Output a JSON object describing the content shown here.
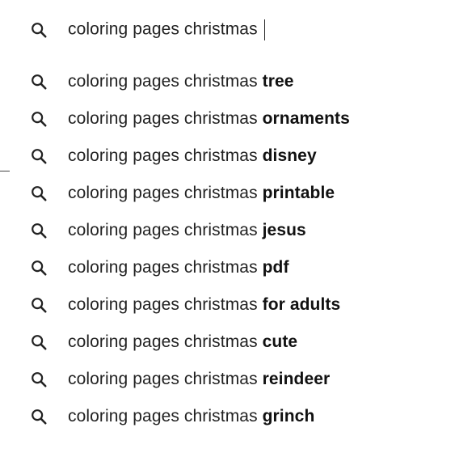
{
  "search": {
    "query": "coloring pages christmas",
    "icon": "search-icon"
  },
  "suggestions": {
    "prefix": "coloring pages christmas",
    "icon": "search-icon",
    "items": [
      {
        "completion": "tree"
      },
      {
        "completion": "ornaments"
      },
      {
        "completion": "disney"
      },
      {
        "completion": "printable"
      },
      {
        "completion": "jesus"
      },
      {
        "completion": "pdf"
      },
      {
        "completion": "for adults"
      },
      {
        "completion": "cute"
      },
      {
        "completion": "reindeer"
      },
      {
        "completion": "grinch"
      }
    ]
  }
}
